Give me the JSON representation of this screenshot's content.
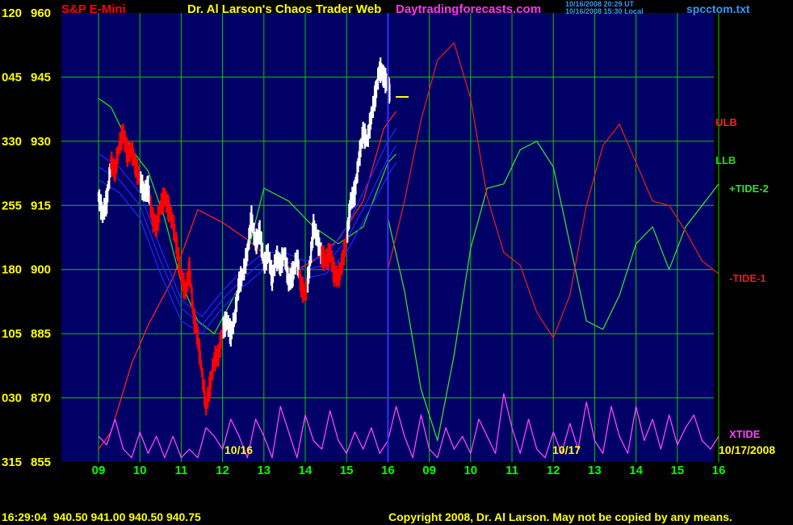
{
  "header": {
    "symbol_label": "S&P E-Mini",
    "title": "Dr. Al Larson's Chaos Trader Web",
    "website": "Daytradingforecasts.com",
    "ut_time": "10/16/2008 20:29 UT",
    "local_time": "10/16/2008 15:30 Local",
    "filename": "spcctom.txt"
  },
  "footer": {
    "quote": "16:29:04  940.50 941.00 940.50 940.75",
    "copyright": "Copyright 2008, Dr. Al Larson. May not be copied by any means."
  },
  "colors": {
    "background": "#000000",
    "plot_background": "#000066",
    "grid": "#00cc00",
    "price_up": "#ffffff",
    "price_down": "#ff0000",
    "ulb": "#ff2020",
    "llb": "#22dd22",
    "tide_plus": "#33dd33",
    "tide_minus": "#dd2020",
    "xtide": "#ff44ff",
    "band_blue": "#2222ff",
    "cursor": "#3333ff",
    "left_label": "#ffff00",
    "hour_label": "#00ff00",
    "title_yellow": "#ffff00",
    "title_red": "#ff0000",
    "site_magenta": "#ff33ff",
    "filename_blue": "#3399ff"
  },
  "chart_data": {
    "type": "line",
    "title": "Dr. Al Larson's Chaos Trader Web",
    "price_axis": {
      "ticks": [
        960,
        945,
        930,
        915,
        900,
        885,
        870,
        855
      ],
      "ylim": [
        855,
        960
      ]
    },
    "angle_axis": {
      "ticks": [
        "120",
        "045",
        "330",
        "255",
        "180",
        "105",
        "030",
        "315"
      ]
    },
    "hour_ticks": [
      "09",
      "10",
      "11",
      "12",
      "13",
      "14",
      "15",
      "16",
      "09",
      "10",
      "11",
      "12",
      "13",
      "14",
      "15",
      "16"
    ],
    "date_labels": [
      "10/16",
      "10/17",
      "10/17/2008"
    ],
    "cursor_hour_index": 7,
    "right_labels": [
      "ULB",
      "LLB",
      "+TIDE-2",
      "-TIDE-1",
      "XTIDE"
    ],
    "series": [
      {
        "name": "ULB",
        "kind": "band",
        "points": [
          [
            0,
            858
          ],
          [
            0.3,
            862
          ],
          [
            0.8,
            878
          ],
          [
            1.2,
            887
          ],
          [
            1.8,
            898
          ],
          [
            2.4,
            914
          ],
          [
            3.0,
            911
          ],
          [
            3.6,
            907
          ],
          [
            4.2,
            902
          ],
          [
            4.8,
            900
          ],
          [
            5.2,
            902
          ],
          [
            5.8,
            907
          ],
          [
            6.4,
            916
          ],
          [
            6.9,
            933
          ],
          [
            7.2,
            937
          ]
        ]
      },
      {
        "name": "LLB",
        "kind": "band",
        "points": [
          [
            0,
            940
          ],
          [
            0.3,
            938
          ],
          [
            0.8,
            928
          ],
          [
            1.2,
            923
          ],
          [
            1.6,
            912
          ],
          [
            2.0,
            897
          ],
          [
            2.4,
            888
          ],
          [
            2.8,
            885
          ],
          [
            3.4,
            896
          ],
          [
            4.0,
            919
          ],
          [
            4.6,
            916
          ],
          [
            5.2,
            910
          ],
          [
            5.8,
            906
          ],
          [
            6.4,
            910
          ],
          [
            7.0,
            925
          ],
          [
            7.2,
            927
          ]
        ]
      },
      {
        "name": "blue-band-1",
        "kind": "blue",
        "points": [
          [
            0,
            927
          ],
          [
            0.5,
            924
          ],
          [
            1.0,
            918
          ],
          [
            1.5,
            905
          ],
          [
            2.0,
            893
          ],
          [
            2.5,
            889
          ],
          [
            3.0,
            895
          ],
          [
            3.5,
            900
          ],
          [
            4.0,
            904
          ],
          [
            4.5,
            904
          ],
          [
            5.0,
            902
          ],
          [
            5.5,
            903
          ],
          [
            6.0,
            910
          ],
          [
            6.5,
            920
          ],
          [
            7.0,
            930
          ],
          [
            7.2,
            933
          ]
        ]
      },
      {
        "name": "blue-band-2",
        "kind": "blue",
        "points": [
          [
            0,
            924
          ],
          [
            0.5,
            921
          ],
          [
            1.0,
            915
          ],
          [
            1.5,
            902
          ],
          [
            2.0,
            891
          ],
          [
            2.5,
            887
          ],
          [
            3.0,
            893
          ],
          [
            3.5,
            898
          ],
          [
            4.0,
            902
          ],
          [
            4.5,
            902
          ],
          [
            5.0,
            900
          ],
          [
            5.5,
            901
          ],
          [
            6.0,
            907
          ],
          [
            6.5,
            916
          ],
          [
            7.0,
            926
          ],
          [
            7.2,
            929
          ]
        ]
      },
      {
        "name": "blue-band-3",
        "kind": "blue",
        "points": [
          [
            0,
            921
          ],
          [
            0.5,
            918
          ],
          [
            1.0,
            912
          ],
          [
            1.5,
            899
          ],
          [
            2.0,
            888
          ],
          [
            2.5,
            885
          ],
          [
            3.0,
            891
          ],
          [
            3.5,
            896
          ],
          [
            4.0,
            900
          ],
          [
            4.5,
            900
          ],
          [
            5.0,
            898
          ],
          [
            5.5,
            899
          ],
          [
            6.0,
            904
          ],
          [
            6.5,
            913
          ],
          [
            7.0,
            922
          ],
          [
            7.2,
            925
          ]
        ]
      },
      {
        "name": "+TIDE-2",
        "kind": "tide_plus",
        "points": [
          [
            7.0,
            912
          ],
          [
            7.4,
            895
          ],
          [
            7.8,
            872
          ],
          [
            8.2,
            860
          ],
          [
            8.6,
            880
          ],
          [
            9.0,
            905
          ],
          [
            9.4,
            919
          ],
          [
            9.8,
            920
          ],
          [
            10.2,
            928
          ],
          [
            10.6,
            930
          ],
          [
            11.0,
            924
          ],
          [
            11.4,
            906
          ],
          [
            11.8,
            888
          ],
          [
            12.2,
            886
          ],
          [
            12.6,
            894
          ],
          [
            13.0,
            906
          ],
          [
            13.4,
            910
          ],
          [
            13.8,
            900
          ],
          [
            14.2,
            910
          ],
          [
            14.6,
            915
          ],
          [
            15.0,
            920
          ]
        ]
      },
      {
        "name": "-TIDE-1",
        "kind": "tide_minus",
        "points": [
          [
            7.0,
            900
          ],
          [
            7.4,
            916
          ],
          [
            7.8,
            935
          ],
          [
            8.2,
            949
          ],
          [
            8.6,
            953
          ],
          [
            9.0,
            940
          ],
          [
            9.4,
            917
          ],
          [
            9.8,
            904
          ],
          [
            10.2,
            901
          ],
          [
            10.6,
            890
          ],
          [
            11.0,
            884
          ],
          [
            11.4,
            894
          ],
          [
            11.8,
            915
          ],
          [
            12.2,
            929
          ],
          [
            12.6,
            934
          ],
          [
            13.0,
            925
          ],
          [
            13.4,
            916
          ],
          [
            13.8,
            915
          ],
          [
            14.2,
            909
          ],
          [
            14.6,
            902
          ],
          [
            15.0,
            899
          ]
        ]
      },
      {
        "name": "XTIDE",
        "kind": "xtide",
        "points": [
          [
            0,
            861
          ],
          [
            0.2,
            859
          ],
          [
            0.4,
            865
          ],
          [
            0.6,
            858
          ],
          [
            0.8,
            856
          ],
          [
            1.0,
            862
          ],
          [
            1.2,
            857
          ],
          [
            1.4,
            861
          ],
          [
            1.6,
            856
          ],
          [
            1.8,
            861
          ],
          [
            2.0,
            856
          ],
          [
            2.2,
            858
          ],
          [
            2.4,
            856
          ],
          [
            2.6,
            863
          ],
          [
            2.8,
            861
          ],
          [
            3.0,
            858
          ],
          [
            3.2,
            865
          ],
          [
            3.4,
            861
          ],
          [
            3.6,
            856
          ],
          [
            3.8,
            865
          ],
          [
            4.0,
            861
          ],
          [
            4.2,
            856
          ],
          [
            4.4,
            868
          ],
          [
            4.6,
            862
          ],
          [
            4.8,
            856
          ],
          [
            5.0,
            866
          ],
          [
            5.2,
            860
          ],
          [
            5.4,
            858
          ],
          [
            5.6,
            867
          ],
          [
            5.8,
            860
          ],
          [
            6.0,
            857
          ],
          [
            6.2,
            862
          ],
          [
            6.4,
            858
          ],
          [
            6.6,
            863
          ],
          [
            6.8,
            857
          ],
          [
            7.0,
            860
          ],
          [
            7.2,
            868
          ],
          [
            7.4,
            861
          ],
          [
            7.6,
            856
          ],
          [
            7.8,
            866
          ],
          [
            8.0,
            858
          ],
          [
            8.2,
            856
          ],
          [
            8.4,
            863
          ],
          [
            8.6,
            858
          ],
          [
            8.8,
            861
          ],
          [
            9.0,
            857
          ],
          [
            9.2,
            865
          ],
          [
            9.4,
            861
          ],
          [
            9.6,
            857
          ],
          [
            9.8,
            871
          ],
          [
            10.0,
            863
          ],
          [
            10.2,
            857
          ],
          [
            10.4,
            865
          ],
          [
            10.6,
            858
          ],
          [
            10.8,
            856
          ],
          [
            11.0,
            862
          ],
          [
            11.2,
            857
          ],
          [
            11.4,
            864
          ],
          [
            11.6,
            858
          ],
          [
            11.8,
            869
          ],
          [
            12.0,
            860
          ],
          [
            12.2,
            857
          ],
          [
            12.4,
            868
          ],
          [
            12.6,
            861
          ],
          [
            12.8,
            857
          ],
          [
            13.0,
            868
          ],
          [
            13.2,
            860
          ],
          [
            13.4,
            865
          ],
          [
            13.6,
            858
          ],
          [
            13.8,
            866
          ],
          [
            14.0,
            859
          ],
          [
            14.2,
            863
          ],
          [
            14.4,
            866
          ],
          [
            14.6,
            860
          ],
          [
            14.8,
            858
          ],
          [
            15.0,
            861
          ]
        ]
      },
      {
        "name": "price",
        "kind": "price",
        "points": [
          [
            0,
            917
          ],
          [
            0.1,
            913
          ],
          [
            0.2,
            916
          ],
          [
            0.3,
            925
          ],
          [
            0.4,
            923
          ],
          [
            0.5,
            929
          ],
          [
            0.6,
            932
          ],
          [
            0.7,
            927
          ],
          [
            0.8,
            928
          ],
          [
            0.9,
            924
          ],
          [
            1.0,
            921
          ],
          [
            1.1,
            918
          ],
          [
            1.2,
            919
          ],
          [
            1.3,
            912
          ],
          [
            1.4,
            910
          ],
          [
            1.5,
            915
          ],
          [
            1.6,
            917
          ],
          [
            1.7,
            914
          ],
          [
            1.8,
            911
          ],
          [
            1.9,
            905
          ],
          [
            2.0,
            898
          ],
          [
            2.1,
            895
          ],
          [
            2.2,
            900
          ],
          [
            2.3,
            889
          ],
          [
            2.4,
            884
          ],
          [
            2.5,
            876
          ],
          [
            2.6,
            868
          ],
          [
            2.7,
            873
          ],
          [
            2.8,
            879
          ],
          [
            2.9,
            880
          ],
          [
            3.0,
            886
          ],
          [
            3.1,
            888
          ],
          [
            3.2,
            885
          ],
          [
            3.3,
            889
          ],
          [
            3.4,
            897
          ],
          [
            3.5,
            899
          ],
          [
            3.6,
            904
          ],
          [
            3.7,
            912
          ],
          [
            3.8,
            906
          ],
          [
            3.9,
            909
          ],
          [
            4.0,
            901
          ],
          [
            4.1,
            904
          ],
          [
            4.2,
            898
          ],
          [
            4.3,
            903
          ],
          [
            4.4,
            901
          ],
          [
            4.5,
            904
          ],
          [
            4.6,
            897
          ],
          [
            4.7,
            899
          ],
          [
            4.8,
            903
          ],
          [
            4.9,
            896
          ],
          [
            5.0,
            894
          ],
          [
            5.1,
            900
          ],
          [
            5.2,
            910
          ],
          [
            5.3,
            907
          ],
          [
            5.4,
            903
          ],
          [
            5.5,
            902
          ],
          [
            5.6,
            904
          ],
          [
            5.7,
            899
          ],
          [
            5.8,
            898
          ],
          [
            5.9,
            902
          ],
          [
            6.0,
            907
          ],
          [
            6.1,
            916
          ],
          [
            6.2,
            918
          ],
          [
            6.3,
            926
          ],
          [
            6.4,
            932
          ],
          [
            6.5,
            930
          ],
          [
            6.6,
            936
          ],
          [
            6.7,
            941
          ],
          [
            6.8,
            947
          ],
          [
            6.9,
            945
          ],
          [
            7.0,
            943
          ],
          [
            7.05,
            941
          ]
        ],
        "down_ranges": [
          [
            0.3,
            1.0
          ],
          [
            1.25,
            3.0
          ],
          [
            4.85,
            5.05
          ],
          [
            5.4,
            6.0
          ]
        ]
      }
    ]
  }
}
